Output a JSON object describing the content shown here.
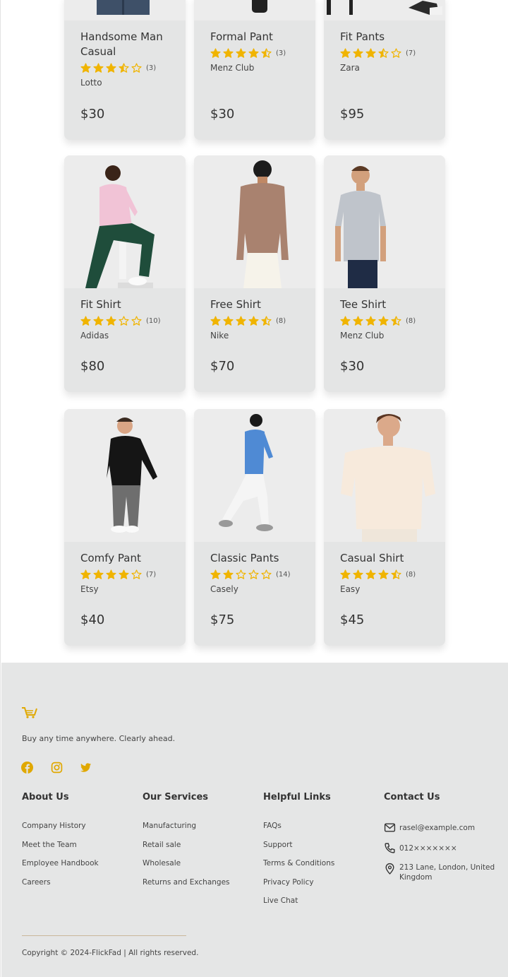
{
  "products": [
    {
      "title": "Handsome Man Casual",
      "rating": 3.5,
      "count": "(3)",
      "brand": "Lotto",
      "price": "$30"
    },
    {
      "title": "Formal Pant",
      "rating": 4.5,
      "count": "(3)",
      "brand": "Menz Club",
      "price": "$30"
    },
    {
      "title": "Fit Pants",
      "rating": 3.5,
      "count": "(7)",
      "brand": "Zara",
      "price": "$95"
    },
    {
      "title": "Fit Shirt",
      "rating": 3,
      "count": "(10)",
      "brand": "Adidas",
      "price": "$80"
    },
    {
      "title": "Free Shirt",
      "rating": 4.5,
      "count": "(8)",
      "brand": "Nike",
      "price": "$70"
    },
    {
      "title": "Tee Shirt",
      "rating": 4.5,
      "count": "(8)",
      "brand": "Menz Club",
      "price": "$30"
    },
    {
      "title": "Comfy Pant",
      "rating": 4,
      "count": "(7)",
      "brand": "Etsy",
      "price": "$40"
    },
    {
      "title": "Classic Pants",
      "rating": 2,
      "count": "(14)",
      "brand": "Casely",
      "price": "$75"
    },
    {
      "title": "Casual Shirt",
      "rating": 4.5,
      "count": "(8)",
      "brand": "Easy",
      "price": "$45"
    }
  ],
  "colors": {
    "star": "#f0b400",
    "accent": "#e0a800",
    "footer_bg": "#e5e6e6"
  },
  "footer": {
    "tagline": "Buy any time anywhere. Clearly ahead.",
    "social_icons": [
      "facebook-icon",
      "instagram-icon",
      "twitter-icon"
    ],
    "about": {
      "title": "About Us",
      "links": [
        "Company History",
        "Meet the Team",
        "Employee Handbook",
        "Careers"
      ]
    },
    "services": {
      "title": "Our Services",
      "links": [
        "Manufacturing",
        "Retail sale",
        "Wholesale",
        "Returns and Exchanges"
      ]
    },
    "helpful": {
      "title": "Helpful Links",
      "links": [
        "FAQs",
        "Support",
        "Terms & Conditions",
        "Privacy Policy",
        "Live Chat"
      ]
    },
    "contact": {
      "title": "Contact Us",
      "email": "rasel@example.com",
      "phone": "012×××××××",
      "address": "213 Lane, London, United Kingdom"
    },
    "copyright": "Copyright © 2024-FlickFad | All rights reserved."
  }
}
